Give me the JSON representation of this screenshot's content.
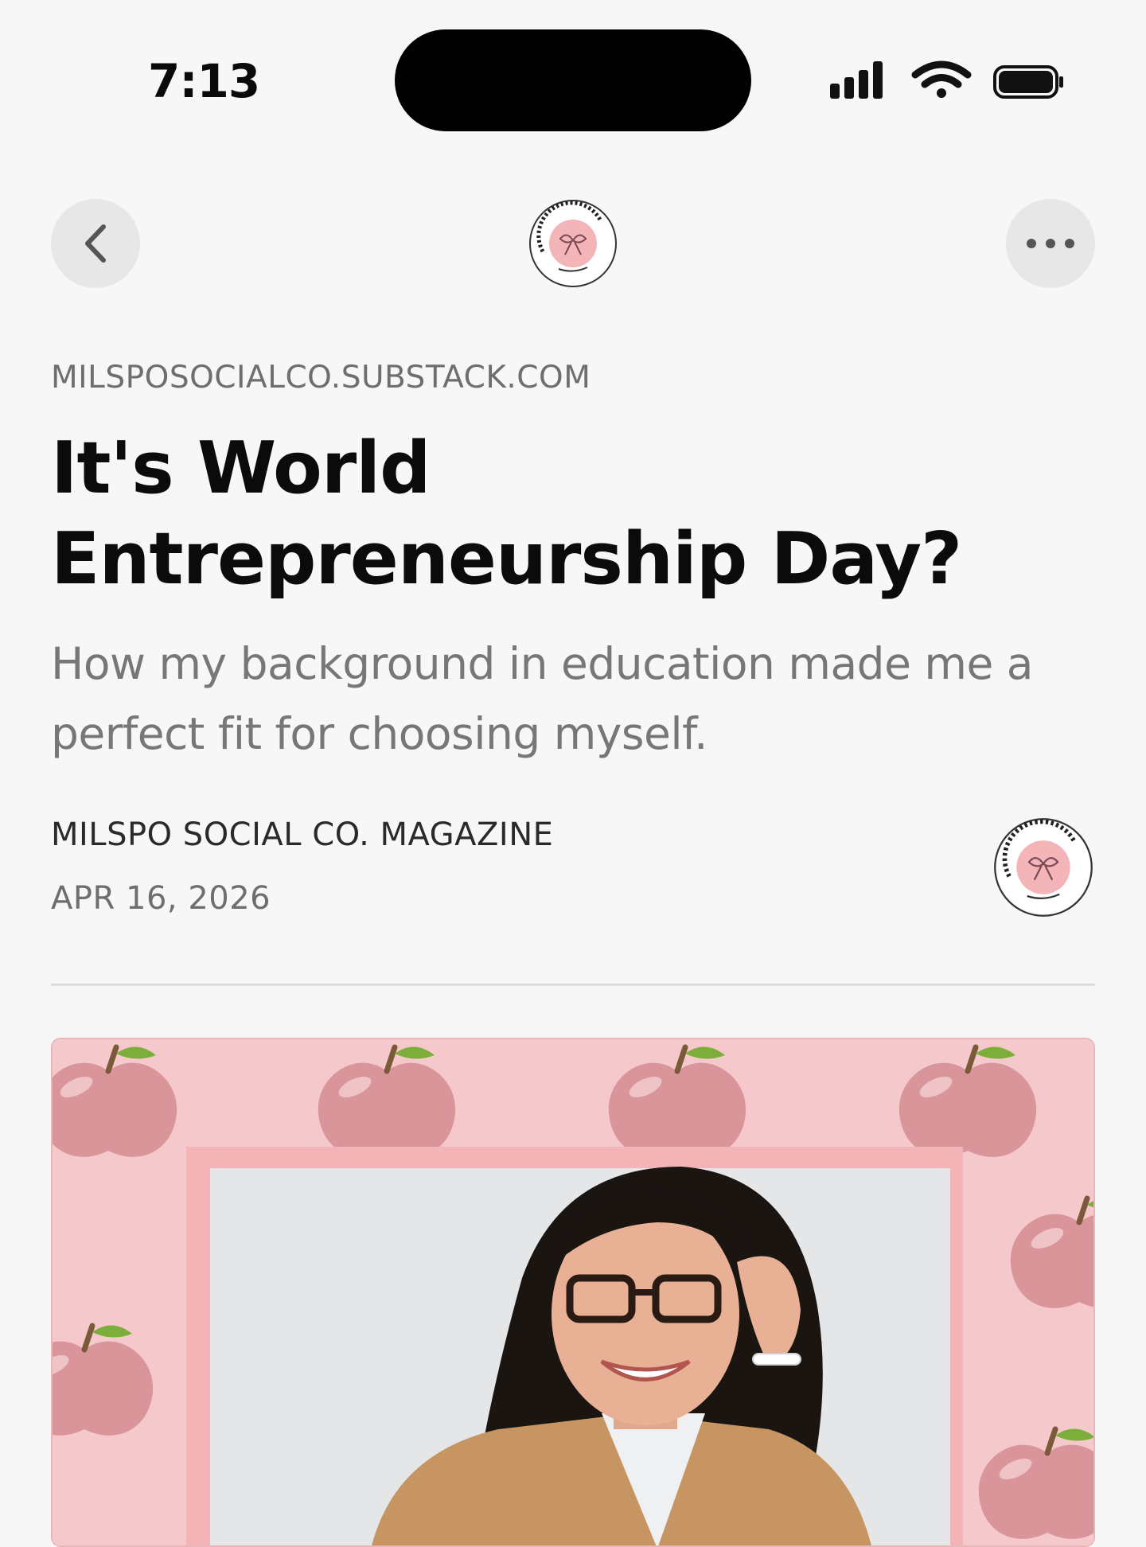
{
  "status_bar": {
    "time": "7:13"
  },
  "nav": {
    "back_icon": "chevron-left-icon",
    "more_icon": "ellipsis-icon",
    "logo_text_top": "MILSPO SOCIAL CO.",
    "logo_text_bottom": "magazine"
  },
  "article": {
    "domain": "MILSPOSOCIALCO.SUBSTACK.COM",
    "title_line1": "It's World",
    "title_line2": "Entrepreneurship Day?",
    "subtitle_line1": "How my background in education made me a",
    "subtitle_line2": "perfect fit for choosing myself.",
    "author": "MILSPO SOCIAL CO. MAGAZINE",
    "date": "APR 16, 2026"
  },
  "colors": {
    "background": "#f7f7f7",
    "hero_pink": "#f5c9cb",
    "apple_pink": "#d9959a",
    "frame_pink": "#f3b4b8",
    "leaf_green": "#7dae3c"
  }
}
